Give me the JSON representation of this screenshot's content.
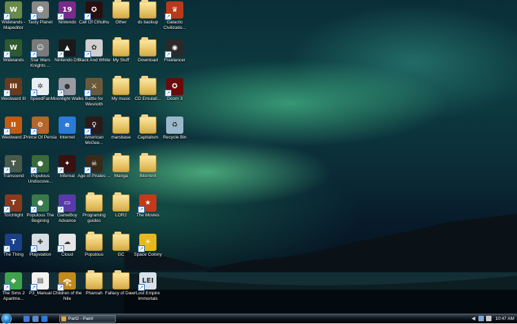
{
  "desktop": {
    "icons": [
      {
        "label": "Widelands - Mapeditor",
        "icon": "widelands-editor-icon",
        "color": "#6a8a4a",
        "type": "app",
        "glyph": "W",
        "col": 0,
        "row": 0
      },
      {
        "label": "Widelands",
        "icon": "widelands-icon",
        "color": "#2e5a2e",
        "type": "app",
        "glyph": "W",
        "col": 0,
        "row": 1
      },
      {
        "label": "Westward III",
        "icon": "westward-iii-icon",
        "color": "#6b3a1a",
        "type": "app",
        "glyph": "III",
        "col": 0,
        "row": 2
      },
      {
        "label": "Westward 2",
        "icon": "westward-2-icon",
        "color": "#c25a10",
        "type": "app",
        "glyph": "II",
        "col": 0,
        "row": 3
      },
      {
        "label": "Transcend",
        "icon": "transcend-icon",
        "color": "#4a5a4a",
        "type": "app",
        "glyph": "T",
        "col": 0,
        "row": 4
      },
      {
        "label": "Torchlight",
        "icon": "torchlight-icon",
        "color": "#8a3a1a",
        "type": "app",
        "glyph": "T",
        "col": 0,
        "row": 5
      },
      {
        "label": "The Thing",
        "icon": "the-thing-icon",
        "color": "#1b3f88",
        "type": "app",
        "glyph": "T",
        "col": 0,
        "row": 6
      },
      {
        "label": "The Sims 2 Apartme...",
        "icon": "sims-2-icon",
        "color": "#3fa34d",
        "type": "app",
        "glyph": "◆",
        "col": 0,
        "row": 7
      },
      {
        "label": "Tasty Planet",
        "icon": "tasty-planet-icon",
        "color": "#888888",
        "type": "app",
        "glyph": "☻",
        "col": 1,
        "row": 0
      },
      {
        "label": "Star Wars Knights ...",
        "icon": "star-wars-icon",
        "color": "#7a7a7a",
        "type": "app",
        "glyph": "☺",
        "col": 1,
        "row": 1
      },
      {
        "label": "SpeedFan",
        "icon": "speedfan-icon",
        "color": "#e8eef2",
        "type": "app",
        "glyph": "✲",
        "col": 1,
        "row": 2
      },
      {
        "label": "Prince Of Persia",
        "icon": "prince-of-persia-icon",
        "color": "#b5662a",
        "type": "app",
        "glyph": "⚙",
        "col": 1,
        "row": 3
      },
      {
        "label": "Populous Undiscove...",
        "icon": "populous-undiscovered-icon",
        "color": "#3a6a3a",
        "type": "app",
        "glyph": "●",
        "col": 1,
        "row": 4
      },
      {
        "label": "Populous The Begining",
        "icon": "populous-icon",
        "color": "#3a7a4a",
        "type": "app",
        "glyph": "●",
        "col": 1,
        "row": 5
      },
      {
        "label": "Playstation",
        "icon": "playstation-icon",
        "color": "#d8dde2",
        "type": "app",
        "glyph": "✚",
        "col": 1,
        "row": 6
      },
      {
        "label": "P3_Manual",
        "icon": "pdf-document-icon",
        "color": "#f2f2f2",
        "type": "app",
        "glyph": "▤",
        "col": 1,
        "row": 7
      },
      {
        "label": "Nintendo",
        "icon": "nintendo-icon",
        "color": "#7a2a8a",
        "type": "app",
        "glyph": "19",
        "col": 2,
        "row": 0
      },
      {
        "label": "Nintendo DS",
        "icon": "nintendo-ds-icon",
        "color": "#1a1a1a",
        "type": "app",
        "glyph": "▲",
        "col": 2,
        "row": 1
      },
      {
        "label": "Moonlight Walks",
        "icon": "moonlight-walks-icon",
        "color": "#9a9aa2",
        "type": "app",
        "glyph": "●",
        "col": 2,
        "row": 2
      },
      {
        "label": "Internet",
        "icon": "internet-explorer-icon",
        "color": "#2a7ad8",
        "type": "app",
        "glyph": "e",
        "col": 2,
        "row": 3
      },
      {
        "label": "Infernal",
        "icon": "infernal-icon",
        "color": "#3a1010",
        "type": "app",
        "glyph": "✦",
        "col": 2,
        "row": 4
      },
      {
        "label": "GameBoy Advance",
        "icon": "gameboy-advance-icon",
        "color": "#5a3aa8",
        "type": "app",
        "glyph": "▭",
        "col": 2,
        "row": 5
      },
      {
        "label": "Cloud",
        "icon": "cloud-icon",
        "color": "#e6e6e6",
        "type": "app",
        "glyph": "☁",
        "col": 2,
        "row": 6
      },
      {
        "label": "Children of the Nile",
        "icon": "children-of-the-nile-icon",
        "color": "#c28a1a",
        "type": "app",
        "glyph": "𓂀",
        "col": 2,
        "row": 7
      },
      {
        "label": "Call Of Cthulhu",
        "icon": "call-of-cthulhu-icon",
        "color": "#2a0f0f",
        "type": "app",
        "glyph": "✪",
        "col": 3,
        "row": 0
      },
      {
        "label": "Black And White",
        "icon": "black-and-white-icon",
        "color": "#cfcfcf",
        "type": "app",
        "glyph": "✿",
        "col": 3,
        "row": 1
      },
      {
        "label": "Battle for Wesnoth",
        "icon": "battle-for-wesnoth-icon",
        "color": "#6a5a3a",
        "type": "app",
        "glyph": "⚔",
        "col": 3,
        "row": 2
      },
      {
        "label": "American McGee...",
        "icon": "american-mcgee-icon",
        "color": "#2a1a1a",
        "type": "app",
        "glyph": "♀",
        "col": 3,
        "row": 3
      },
      {
        "label": "Age of Pirates ...",
        "icon": "age-of-pirates-icon",
        "color": "#3a2a1a",
        "type": "app",
        "glyph": "☠",
        "col": 3,
        "row": 4
      },
      {
        "label": "Programing guides",
        "icon": "folder-icon",
        "type": "folder",
        "col": 3,
        "row": 5
      },
      {
        "label": "Populous",
        "icon": "folder-icon",
        "type": "folder",
        "col": 3,
        "row": 6
      },
      {
        "label": "Pharoah",
        "icon": "folder-icon",
        "type": "folder",
        "col": 3,
        "row": 7
      },
      {
        "label": "Other",
        "icon": "folder-icon",
        "type": "folder",
        "col": 4,
        "row": 0
      },
      {
        "label": "My Stuff",
        "icon": "folder-icon",
        "type": "folder",
        "col": 4,
        "row": 1
      },
      {
        "label": "My music",
        "icon": "music-folder-icon",
        "type": "folder",
        "col": 4,
        "row": 2
      },
      {
        "label": "marsbase",
        "icon": "folder-icon",
        "type": "folder",
        "col": 4,
        "row": 3
      },
      {
        "label": "Manga",
        "icon": "folder-icon",
        "type": "folder",
        "col": 4,
        "row": 4
      },
      {
        "label": "LOR2",
        "icon": "folder-icon",
        "type": "folder",
        "col": 4,
        "row": 5
      },
      {
        "label": "GC",
        "icon": "folder-icon",
        "type": "folder",
        "col": 4,
        "row": 6
      },
      {
        "label": "Fallacy of Dawn",
        "icon": "folder-icon",
        "type": "folder",
        "col": 4,
        "row": 7
      },
      {
        "label": "ds backup",
        "icon": "folder-icon",
        "type": "folder",
        "col": 5,
        "row": 0
      },
      {
        "label": "Download",
        "icon": "folder-icon",
        "type": "folder",
        "col": 5,
        "row": 1
      },
      {
        "label": "CD Emulati...",
        "icon": "folder-icon",
        "type": "folder",
        "col": 5,
        "row": 2
      },
      {
        "label": "Capitalism",
        "icon": "folder-icon",
        "type": "folder",
        "col": 5,
        "row": 3
      },
      {
        "label": "Bitorrent",
        "icon": "folder-icon",
        "type": "folder",
        "col": 5,
        "row": 4
      },
      {
        "label": "The Movies",
        "icon": "the-movies-icon",
        "color": "#c23a1a",
        "type": "app",
        "glyph": "★",
        "col": 5,
        "row": 5
      },
      {
        "label": "Space Colony",
        "icon": "space-colony-icon",
        "color": "#e8b81a",
        "type": "app",
        "glyph": "☀",
        "col": 5,
        "row": 6
      },
      {
        "label": "Lost Empire Immortals",
        "icon": "lost-empire-icon",
        "color": "#d8e2ea",
        "type": "app",
        "glyph": "LEI",
        "col": 5,
        "row": 7
      },
      {
        "label": "Galactic Civilizatio...",
        "icon": "galactic-civilizations-icon",
        "color": "#b83a1a",
        "type": "app",
        "glyph": "♛",
        "col": 6,
        "row": 0
      },
      {
        "label": "Freelancer",
        "icon": "freelancer-icon",
        "color": "#2a2a2a",
        "type": "app",
        "glyph": "◉",
        "col": 6,
        "row": 1
      },
      {
        "label": "Doom 3",
        "icon": "doom-3-icon",
        "color": "#6a0a0a",
        "type": "app",
        "glyph": "✪",
        "col": 6,
        "row": 2
      },
      {
        "label": "Recycle Bin",
        "icon": "recycle-bin-icon",
        "color": "#9ab8cc",
        "type": "app",
        "glyph": "♻",
        "col": 6,
        "row": 3
      }
    ]
  },
  "taskbar": {
    "quick_launch": [
      {
        "icon": "show-desktop-icon",
        "color": "#3a7ad8"
      },
      {
        "icon": "switch-windows-icon",
        "color": "#5a8ac8"
      },
      {
        "icon": "internet-explorer-icon",
        "color": "#2a7ad8"
      }
    ],
    "active_task": {
      "label": "Part2 - Paint",
      "icon": "paint-icon"
    },
    "tray_arrow": "◀",
    "tray_icons": [
      {
        "icon": "network-icon",
        "color": "#7aa8d8"
      },
      {
        "icon": "volume-icon",
        "color": "#c8c8c8"
      }
    ],
    "clock": "10:47 AM"
  }
}
